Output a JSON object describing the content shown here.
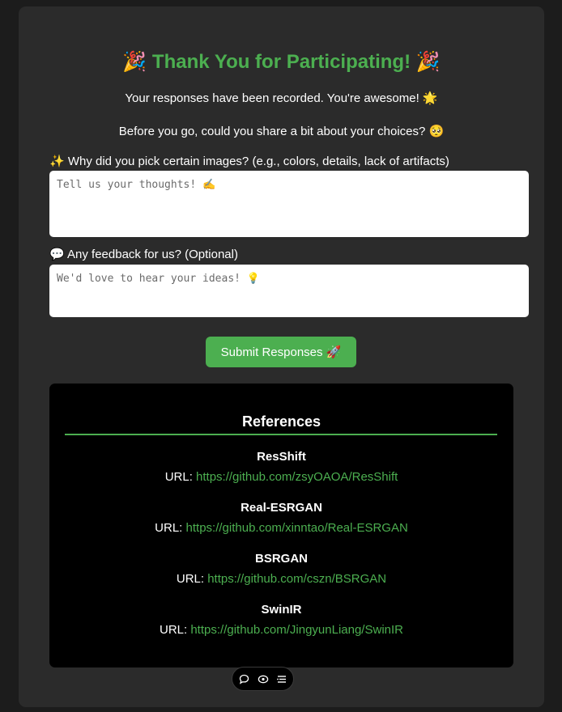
{
  "header": {
    "title": "🎉 Thank You for Participating! 🎉",
    "line1": "Your responses have been recorded. You're awesome! 🌟",
    "line2": "Before you go, could you share a bit about your choices? 🥺"
  },
  "form": {
    "q1_label": "✨ Why did you pick certain images? (e.g., colors, details, lack of artifacts)",
    "q1_placeholder": "Tell us your thoughts! ✍️",
    "q1_value": "",
    "q2_label": "💬 Any feedback for us? (Optional)",
    "q2_placeholder": "We'd love to hear your ideas! 💡",
    "q2_value": "",
    "submit_label": "Submit Responses 🚀"
  },
  "references": {
    "title": "References",
    "url_prefix": "URL: ",
    "items": [
      {
        "name": "ResShift",
        "url": "https://github.com/zsyOAOA/ResShift"
      },
      {
        "name": "Real-ESRGAN",
        "url": "https://github.com/xinntao/Real-ESRGAN"
      },
      {
        "name": "BSRGAN",
        "url": "https://github.com/cszn/BSRGAN"
      },
      {
        "name": "SwinIR",
        "url": "https://github.com/JingyunLiang/SwinIR"
      }
    ]
  },
  "toolbar": {
    "icons": [
      "speech-bubble-icon",
      "eye-toggle-icon",
      "menu-list-icon"
    ]
  },
  "colors": {
    "accent": "#4caf50",
    "page_bg": "#1c1c1c",
    "card_bg": "#2b2b2b",
    "refs_bg": "#000000"
  }
}
